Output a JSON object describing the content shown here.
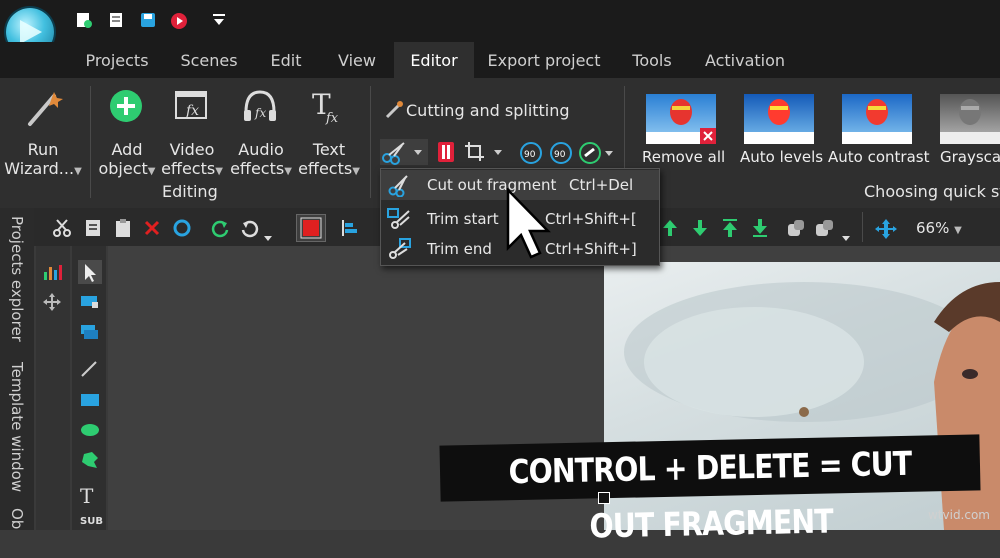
{
  "menu_tabs": [
    {
      "label": "Projects",
      "active": false
    },
    {
      "label": "Scenes",
      "active": false
    },
    {
      "label": "Edit",
      "active": false
    },
    {
      "label": "View",
      "active": false
    },
    {
      "label": "Editor",
      "active": true
    },
    {
      "label": "Export project",
      "active": false
    },
    {
      "label": "Tools",
      "active": false
    },
    {
      "label": "Activation",
      "active": false
    }
  ],
  "ribbon": {
    "run_wizard": {
      "line1": "Run",
      "line2": "Wizard..."
    },
    "add_object": {
      "line1": "Add",
      "line2": "object"
    },
    "video_effects": {
      "line1": "Video",
      "line2": "effects"
    },
    "audio_effects": {
      "line1": "Audio",
      "line2": "effects"
    },
    "text_effects": {
      "line1": "Text",
      "line2": "effects"
    },
    "editing_group": "Editing",
    "cutting_title": "Cutting and splitting",
    "rotate_90_left": "90",
    "rotate_90_right": "90",
    "quick_styles": [
      {
        "label": "Remove all"
      },
      {
        "label": "Auto levels"
      },
      {
        "label": "Auto contrast"
      },
      {
        "label": "Grayscale"
      }
    ],
    "quick_styles_group": "Choosing quick sty"
  },
  "dropdown": {
    "items": [
      {
        "label": "Cut out fragment",
        "shortcut": "Ctrl+Del",
        "highlighted": true
      },
      {
        "label": "Trim start",
        "shortcut": "Ctrl+Shift+[",
        "highlighted": false
      },
      {
        "label": "Trim end",
        "shortcut": "Ctrl+Shift+]",
        "highlighted": false
      }
    ]
  },
  "toolbar": {
    "zoom": "66%"
  },
  "side_tabs": [
    "Projects explorer",
    "Template window",
    "Ob"
  ],
  "caption": "CONTROL + DELETE = CUT OUT FRAGMENT",
  "watermark": "wtvid.com",
  "colors": {
    "accent_green": "#2ecc71",
    "accent_blue": "#29a3e0",
    "delete_red": "#e02020",
    "record_red": "#e0213a"
  },
  "icons": [
    "app-logo-icon",
    "new-project-icon",
    "open-project-icon",
    "save-icon",
    "record-icon",
    "quick-access-dropdown-icon",
    "wand-icon",
    "add-circle-icon",
    "video-fx-icon",
    "audio-fx-icon",
    "text-fx-icon",
    "scissors-icon",
    "crop-icon",
    "rotate-left-icon",
    "rotate-right-icon",
    "stabilize-icon"
  ]
}
